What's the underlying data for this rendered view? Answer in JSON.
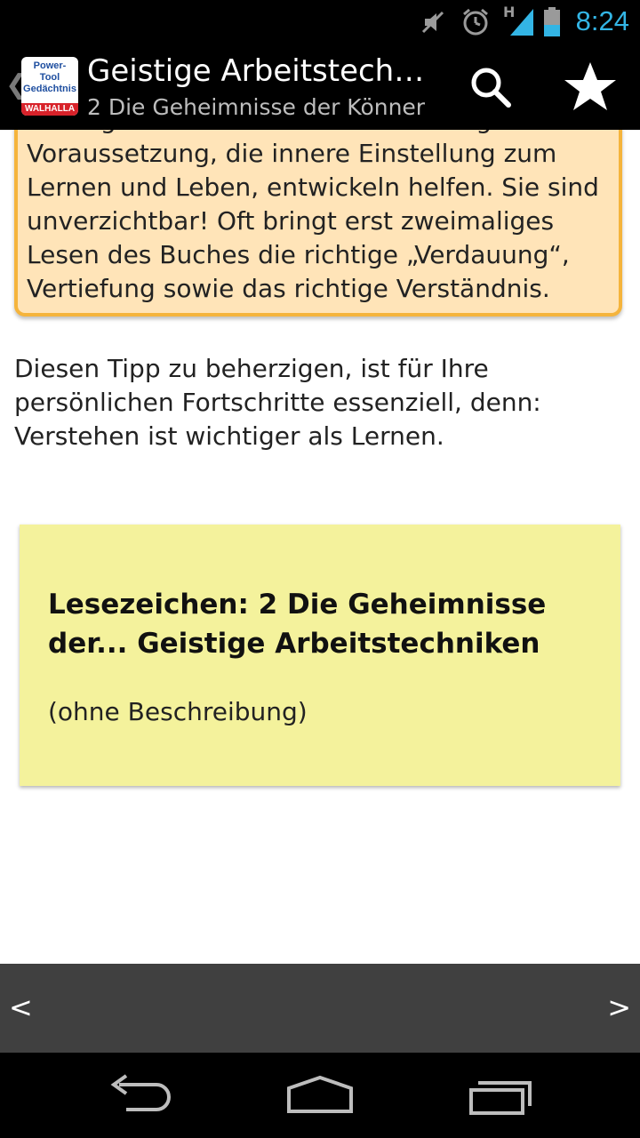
{
  "status_bar": {
    "time": "8:24",
    "network_label": "H",
    "icons": [
      "muted-speaker-icon",
      "alarm-clock-icon",
      "signal-icon",
      "battery-icon"
    ]
  },
  "action_bar": {
    "up_caret": "❮",
    "logo": {
      "line1": "Power-",
      "line2": "Tool",
      "line3": "Gedächtnis",
      "band": "WALHALLA"
    },
    "title": "Geistige Arbeitstechniken",
    "subtitle": "2 Die Geheimnisse der Könner",
    "actions": [
      "search-icon",
      "star-icon"
    ]
  },
  "content": {
    "tip_box": {
      "text": "Eintragen verbessern und die wichtigste Voraussetzung, die innere Einstellung zum Lernen und Leben, entwickeln helfen. Sie sind unverzichtbar! Oft bringt erst zweimaliges Lesen des Buches die richtige „Verdauung“, Vertiefung sowie das richtige Verständnis."
    },
    "paragraph": "Diesen Tipp zu beherzigen, ist für Ihre persönlichen Fortschritte essenziell, denn: Verstehen ist wichtiger als Lernen.",
    "bookmark": {
      "title": "Lesezeichen: 2 Die Geheimnisse der... Geistige Arbeitstechniken",
      "description": "(ohne Beschreibung)"
    }
  },
  "pager": {
    "prev": "<",
    "next": ">"
  },
  "nav_bar": {
    "buttons": [
      "back-icon",
      "home-icon",
      "recent-apps-icon"
    ]
  },
  "colors": {
    "accent": "#33b5e5",
    "tip_bg": "#ffe4b8",
    "tip_border": "#f5b43c",
    "note_bg": "#f4f29c",
    "pager_bg": "#404040"
  }
}
